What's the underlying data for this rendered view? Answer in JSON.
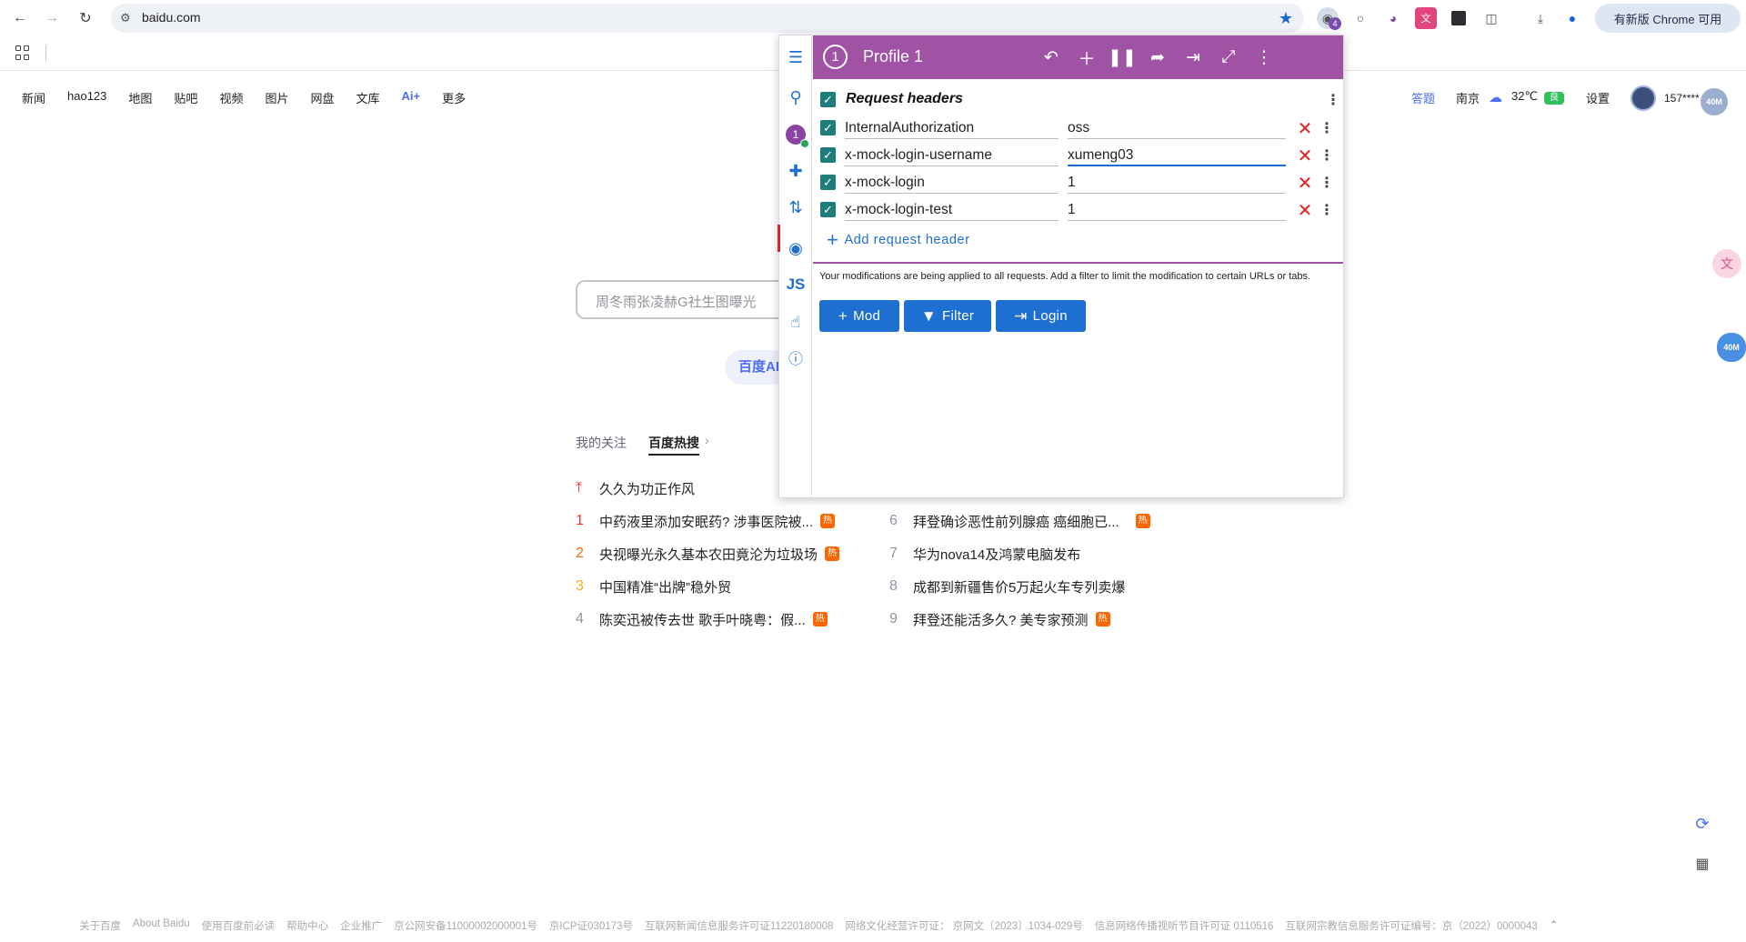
{
  "browser": {
    "url": "baidu.com",
    "update_chip": "有新版 Chrome 可用",
    "ext_badge": "4"
  },
  "baidu": {
    "nav": [
      "新闻",
      "hao123",
      "地图",
      "贴吧",
      "视频",
      "图片",
      "网盘",
      "文库",
      "Ai+",
      "更多"
    ],
    "answer": "答题",
    "city": "南京",
    "temperature": "32℃",
    "air_quality": "良",
    "settings": "设置",
    "user": "157****",
    "speed_badge": "40M",
    "search_placeholder": "周冬雨张凌赫G社生图曝光",
    "ai_button": "百度AI",
    "tab_follow": "我的关注",
    "tab_hot": "百度热搜",
    "hot_top": "久久为功正作风",
    "hot_list": [
      {
        "num": "1",
        "text": "中药液里添加安眠药? 涉事医院被...",
        "hot": true,
        "color": "#f73131"
      },
      {
        "num": "2",
        "text": "央视曝光永久基本农田竟沦为垃圾场",
        "hot": true,
        "color": "#ff6600"
      },
      {
        "num": "3",
        "text": "中国精准“出牌”稳外贸",
        "hot": false,
        "color": "#faa90e"
      },
      {
        "num": "4",
        "text": "陈奕迅被传去世 歌手叶晓粤：假...",
        "hot": true,
        "color": "#9195a3"
      },
      {
        "num": "6",
        "text": "拜登确诊恶性前列腺癌 癌细胞已...",
        "hot": true,
        "color": "#9195a3"
      },
      {
        "num": "7",
        "text": "华为nova14及鸿蒙电脑发布",
        "hot": false,
        "color": "#9195a3"
      },
      {
        "num": "8",
        "text": "成都到新疆售价5万起火车专列卖爆",
        "hot": false,
        "color": "#9195a3"
      },
      {
        "num": "9",
        "text": "拜登还能活多久? 美专家预测",
        "hot": true,
        "color": "#9195a3"
      }
    ],
    "hot_tag": "热",
    "footer": [
      "关于百度",
      "About Baidu",
      "使用百度前必读",
      "帮助中心",
      "企业推广",
      "京公网安备11000002000001号",
      "京ICP证030173号",
      "互联网新闻信息服务许可证11220180008",
      "网络文化经营许可证： 京网文〔2023〕1034-029号",
      "信息网络传播视听节目许可证 0110516",
      "互联网宗教信息服务许可证编号：京（2022）0000043"
    ]
  },
  "modheader": {
    "profile_number": "1",
    "profile_name": "Profile 1",
    "sidebar_profile": "1",
    "sidebar_js": "JS",
    "section_title": "Request headers",
    "headers": [
      {
        "name": "InternalAuthorization",
        "value": "oss"
      },
      {
        "name": "x-mock-login-username",
        "value": "xumeng03"
      },
      {
        "name": "x-mock-login",
        "value": "1"
      },
      {
        "name": "x-mock-login-test",
        "value": "1"
      }
    ],
    "add_label": "Add request header",
    "note": "Your modifications are being applied to all requests. Add a filter to limit the modification to certain URLs or tabs.",
    "buttons": {
      "mod": "Mod",
      "filter": "Filter",
      "login": "Login"
    },
    "accent": "#a052a5",
    "primary": "#1d6fd1"
  }
}
